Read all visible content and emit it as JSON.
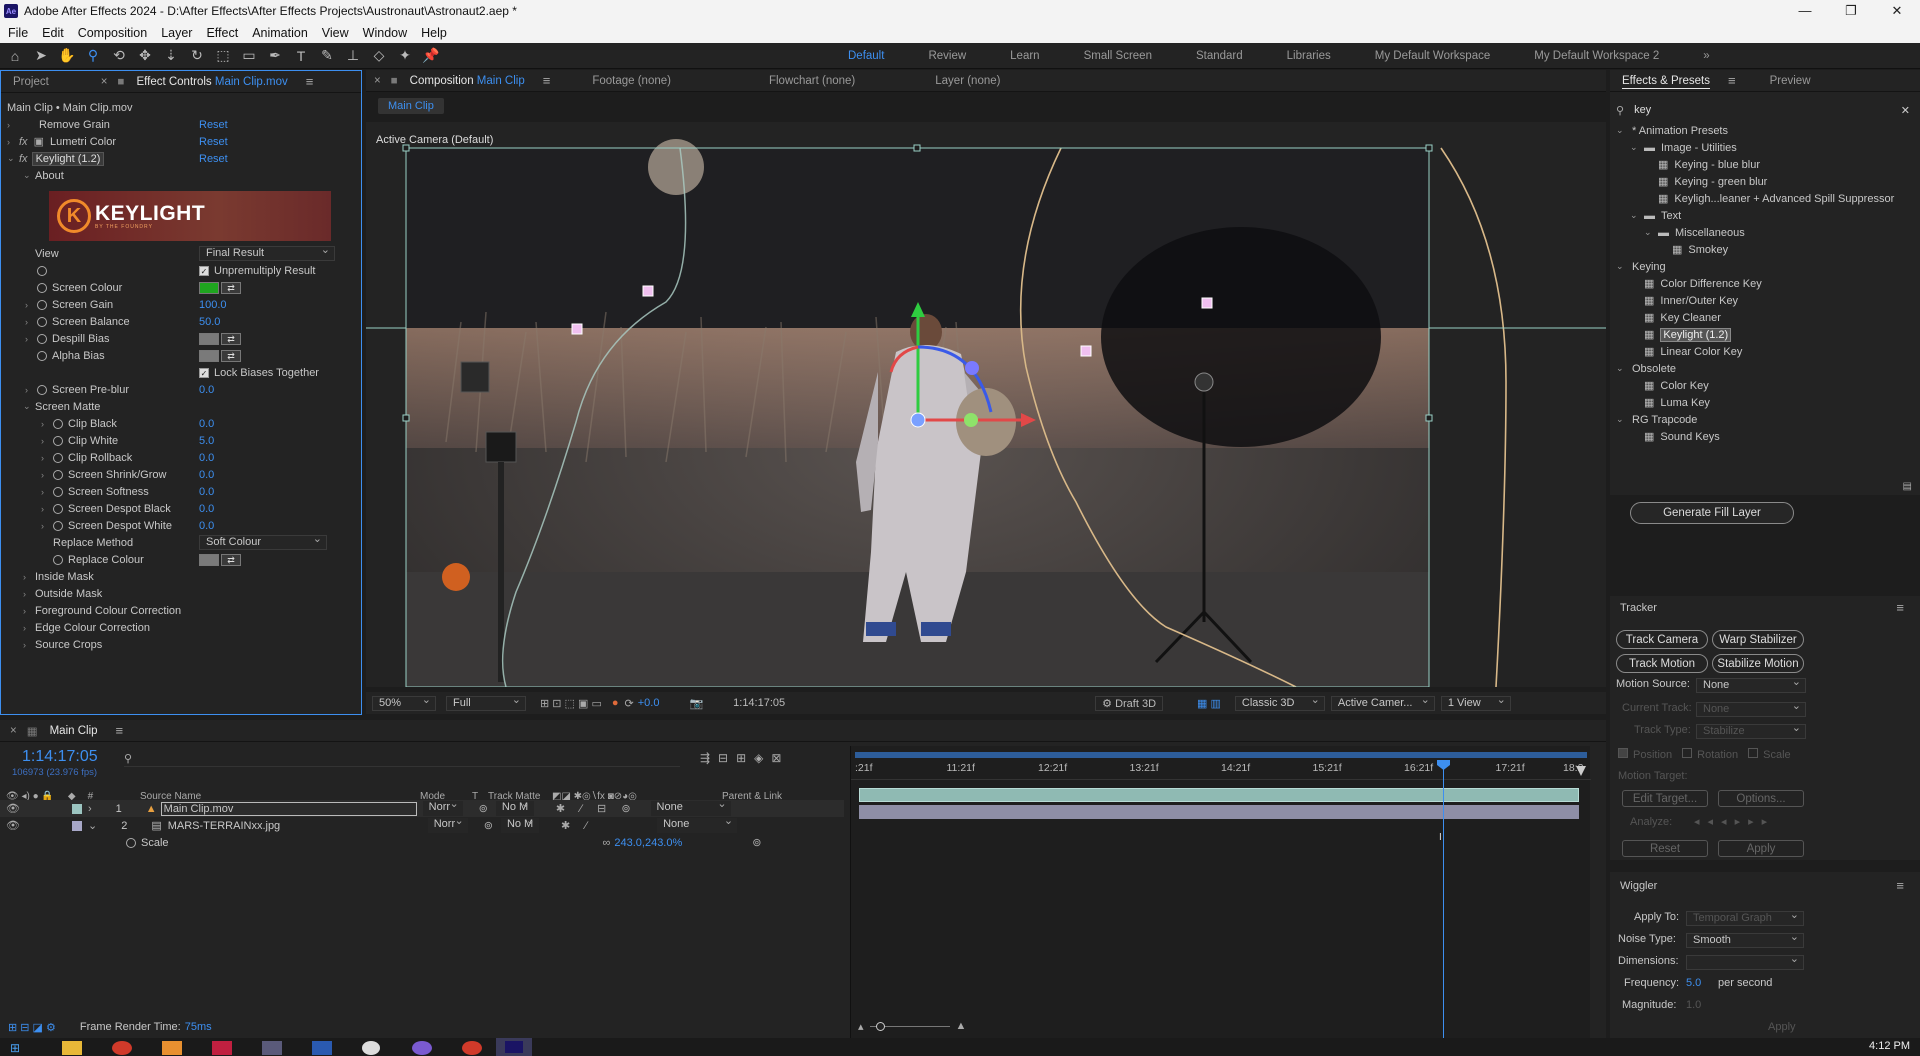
{
  "app": {
    "title": "Adobe After Effects 2024 - D:\\After Effects\\After Effects Projects\\Austronaut\\Astronaut2.aep *",
    "icon_label": "Ae",
    "menu": [
      "File",
      "Edit",
      "Composition",
      "Layer",
      "Effect",
      "Animation",
      "View",
      "Window",
      "Help"
    ]
  },
  "workspaces": [
    "Default",
    "Review",
    "Learn",
    "Small Screen",
    "Standard",
    "Libraries",
    "My Default Workspace",
    "My Default Workspace 2"
  ],
  "left_panel": {
    "tab_project": "Project",
    "tab_effect": "Effect Controls",
    "tab_effect_clip": "Main Clip.mov",
    "breadcrumb": "Main Clip • Main Clip.mov",
    "effects": [
      {
        "name": "Remove Grain",
        "reset": "Reset"
      },
      {
        "name": "Lumetri Color",
        "reset": "Reset"
      },
      {
        "name": "Keylight (1.2)",
        "reset": "Reset"
      }
    ],
    "about": "About",
    "logo_text": "KEYLIGHT",
    "logo_sub": "BY THE FOUNDRY",
    "view_label": "View",
    "view_value": "Final Result",
    "unpremultiply": "Unpremultiply Result",
    "screen_colour": "Screen Colour",
    "screen_gain": {
      "label": "Screen Gain",
      "value": "100.0"
    },
    "screen_balance": {
      "label": "Screen Balance",
      "value": "50.0"
    },
    "despill_bias": "Despill Bias",
    "alpha_bias": "Alpha Bias",
    "lock_biases": "Lock Biases Together",
    "screen_preblur": {
      "label": "Screen Pre-blur",
      "value": "0.0"
    },
    "screen_matte": "Screen Matte",
    "matte_params": [
      {
        "label": "Clip Black",
        "value": "0.0"
      },
      {
        "label": "Clip White",
        "value": "5.0"
      },
      {
        "label": "Clip Rollback",
        "value": "0.0"
      },
      {
        "label": "Screen Shrink/Grow",
        "value": "0.0"
      },
      {
        "label": "Screen Softness",
        "value": "0.0"
      },
      {
        "label": "Screen Despot Black",
        "value": "0.0"
      },
      {
        "label": "Screen Despot White",
        "value": "0.0"
      }
    ],
    "replace_method": {
      "label": "Replace Method",
      "value": "Soft Colour"
    },
    "replace_colour": "Replace Colour",
    "sections": [
      "Inside Mask",
      "Outside Mask",
      "Foreground Colour Correction",
      "Edge Colour Correction",
      "Source Crops"
    ]
  },
  "comp_panel": {
    "tab_comp": "Composition",
    "tab_comp_name": "Main Clip",
    "tab_footage": "Footage (none)",
    "tab_flowchart": "Flowchart (none)",
    "tab_layer": "Layer (none)",
    "comp_button": "Main Clip",
    "camera_label": "Active Camera (Default)",
    "zoom": "50%",
    "resolution": "Full",
    "exposure": "+0.0",
    "timecode": "1:14:17:05",
    "draft3d": "Draft 3D",
    "renderer": "Classic 3D",
    "camera": "Active Camer...",
    "views": "1 View"
  },
  "right_panel": {
    "tab_effects": "Effects & Presets",
    "tab_preview": "Preview",
    "search_value": "key",
    "tree": [
      {
        "label": "* Animation Presets",
        "level": 0,
        "kind": "group"
      },
      {
        "label": "Image - Utilities",
        "level": 1,
        "kind": "folder"
      },
      {
        "label": "Keying - blue blur",
        "level": 2,
        "kind": "item"
      },
      {
        "label": "Keying - green blur",
        "level": 2,
        "kind": "item"
      },
      {
        "label": "Keyligh...leaner + Advanced Spill Suppressor",
        "level": 2,
        "kind": "item"
      },
      {
        "label": "Text",
        "level": 1,
        "kind": "folder"
      },
      {
        "label": "Miscellaneous",
        "level": 2,
        "kind": "folder"
      },
      {
        "label": "Smokey",
        "level": 3,
        "kind": "item"
      },
      {
        "label": "Keying",
        "level": 0,
        "kind": "group"
      },
      {
        "label": "Color Difference Key",
        "level": 1,
        "kind": "item"
      },
      {
        "label": "Inner/Outer Key",
        "level": 1,
        "kind": "item"
      },
      {
        "label": "Key Cleaner",
        "level": 1,
        "kind": "item"
      },
      {
        "label": "Keylight (1.2)",
        "level": 1,
        "kind": "item",
        "selected": true
      },
      {
        "label": "Linear Color Key",
        "level": 1,
        "kind": "item"
      },
      {
        "label": "Obsolete",
        "level": 0,
        "kind": "group"
      },
      {
        "label": "Color Key",
        "level": 1,
        "kind": "item"
      },
      {
        "label": "Luma Key",
        "level": 1,
        "kind": "item"
      },
      {
        "label": "RG Trapcode",
        "level": 0,
        "kind": "group"
      },
      {
        "label": "Sound Keys",
        "level": 1,
        "kind": "item"
      }
    ],
    "generate_fill": "Generate Fill Layer",
    "tracker": {
      "title": "Tracker",
      "track_camera": "Track Camera",
      "warp_stabilizer": "Warp Stabilizer",
      "track_motion": "Track Motion",
      "stabilize_motion": "Stabilize Motion",
      "motion_source_label": "Motion Source:",
      "motion_source_value": "None",
      "current_track_label": "Current Track:",
      "current_track_value": "None",
      "track_type_label": "Track Type:",
      "track_type_value": "Stabilize",
      "position": "Position",
      "rotation": "Rotation",
      "scale": "Scale",
      "motion_target": "Motion Target:",
      "edit_target": "Edit Target...",
      "options": "Options...",
      "analyze": "Analyze:",
      "reset": "Reset",
      "apply": "Apply"
    },
    "wiggler": {
      "title": "Wiggler",
      "apply_to_label": "Apply To:",
      "apply_to_value": "Temporal Graph",
      "noise_type_label": "Noise Type:",
      "noise_type_value": "Smooth",
      "dimensions_label": "Dimensions:",
      "frequency_label": "Frequency:",
      "frequency_value": "5.0",
      "frequency_unit": "per second",
      "magnitude_label": "Magnitude:",
      "magnitude_value": "1.0",
      "apply": "Apply"
    }
  },
  "timeline": {
    "tab": "Main Clip",
    "timecode": "1:14:17:05",
    "frame_info": "106973 (23.976 fps)",
    "col_source": "Source Name",
    "col_mode": "Mode",
    "col_t": "T",
    "col_trackmatte": "Track Matte",
    "col_parent": "Parent & Link",
    "layers": [
      {
        "num": "1",
        "name": "Main Clip.mov",
        "mode": "Norr",
        "matte": "No M",
        "parent": "None"
      },
      {
        "num": "2",
        "name": "MARS-TERRAINxx.jpg",
        "mode": "Norr",
        "matte": "No M",
        "parent": "None"
      }
    ],
    "scale_label": "Scale",
    "scale_value": "243.0,243.0%",
    "ruler": [
      ":21f",
      "11:21f",
      "12:21f",
      "13:21f",
      "14:21f",
      "15:21f",
      "16:21f",
      "17:21f",
      "18:2"
    ],
    "playhead_fraction": 0.8,
    "render_time_label": "Frame Render Time:",
    "render_time_value": "75ms"
  },
  "taskbar": {
    "time": "4:12 PM"
  }
}
